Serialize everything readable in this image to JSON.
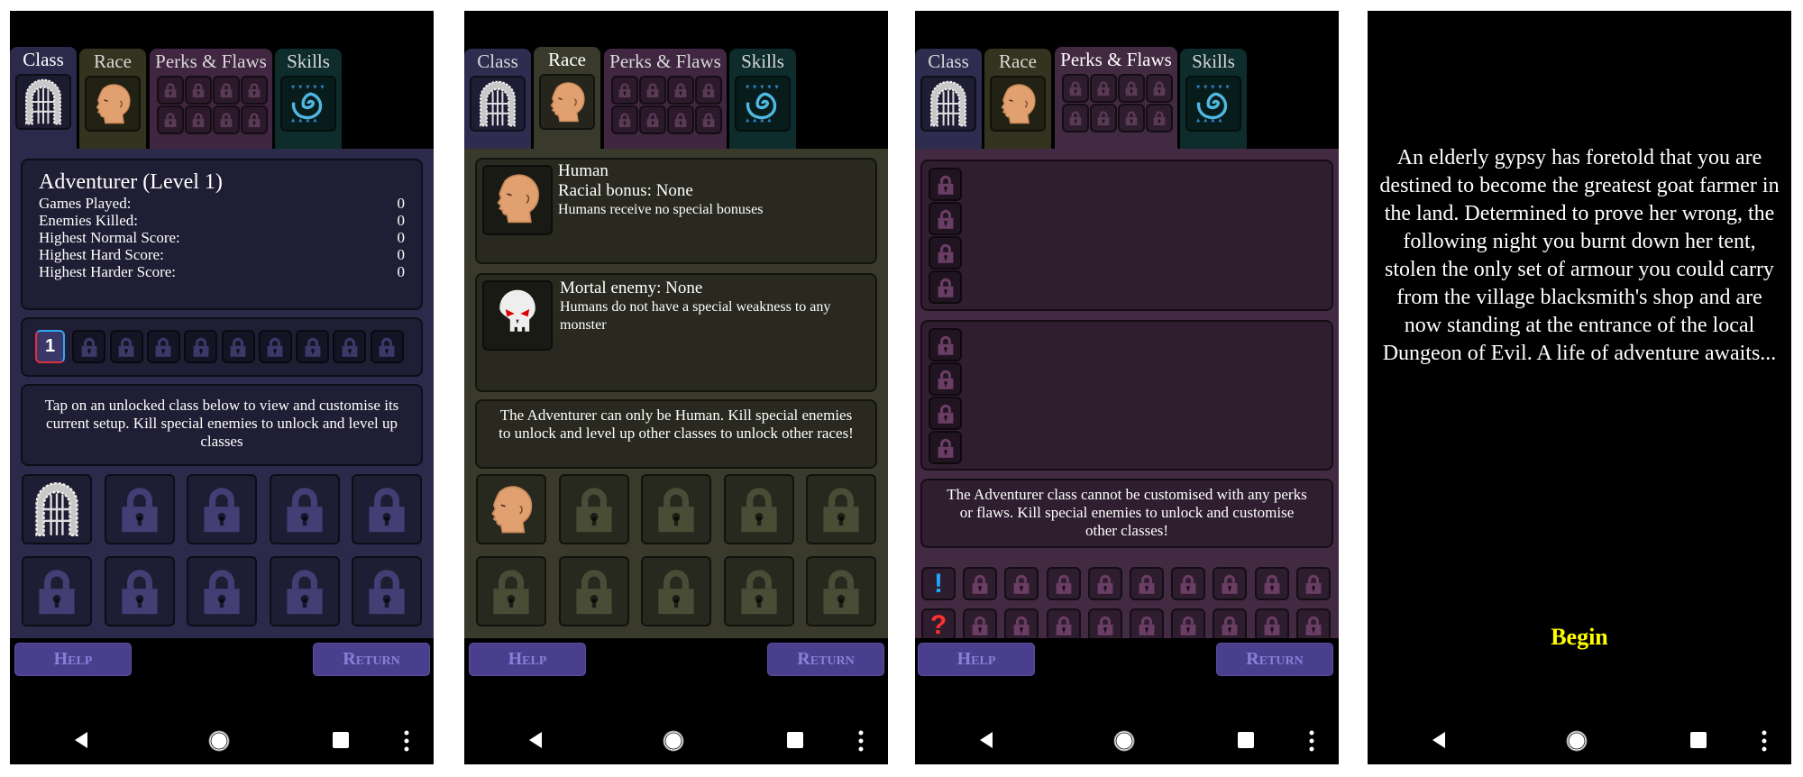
{
  "tabs": {
    "class": "Class",
    "race": "Race",
    "perks": "Perks & Flaws",
    "skills": "Skills"
  },
  "colors": {
    "class_tab": "#2e2d50",
    "race_tab": "#34331f",
    "perks_tab": "#402640",
    "skills_tab": "#0e2c2c",
    "class_bg": "#2b2a4a",
    "race_bg": "#393a2b",
    "perks_bg": "#422a42",
    "button": "#4a3f8c",
    "button_text": "#8a7fd8",
    "begin": "#ffff00"
  },
  "class_screen": {
    "title": "Adventurer (Level 1)",
    "stats": [
      {
        "label": "Games Played:",
        "value": "0"
      },
      {
        "label": "Enemies Killed:",
        "value": "0"
      },
      {
        "label": "Highest Normal Score:",
        "value": "0"
      },
      {
        "label": "Highest Hard Score:",
        "value": "0"
      },
      {
        "label": "Highest Harder Score:",
        "value": "0"
      }
    ],
    "level_badge": "1",
    "info": "Tap on an unlocked class below to view and customise its current setup. Kill special enemies to unlock and level up classes"
  },
  "race_screen": {
    "race_name": "Human",
    "racial_bonus": "Racial bonus: None",
    "bonus_desc": "Humans receive no special bonuses",
    "mortal_enemy": "Mortal enemy: None",
    "enemy_desc": "Humans do not have a special weakness to any monster",
    "info": "The Adventurer can only be Human. Kill special enemies to unlock and level up other classes to unlock other races!"
  },
  "perks_screen": {
    "info": "The Adventurer class cannot be customised with any perks or flaws. Kill special enemies to unlock and customise other classes!",
    "perk_marker": "!",
    "flaw_marker": "?"
  },
  "buttons": {
    "help": "Help",
    "return": "Return"
  },
  "story_screen": {
    "text": "An elderly gypsy has foretold that you are destined to become the greatest goat farmer in the land. Determined to prove her wrong, the following night you burnt down her tent, stolen the only set of armour you could carry from the village blacksmith's shop and are now standing at the entrance of the local Dungeon of Evil. A life of adventure awaits...",
    "begin": "Begin"
  },
  "nav_icons": [
    "back-icon",
    "home-icon",
    "recents-icon",
    "more-icon"
  ]
}
